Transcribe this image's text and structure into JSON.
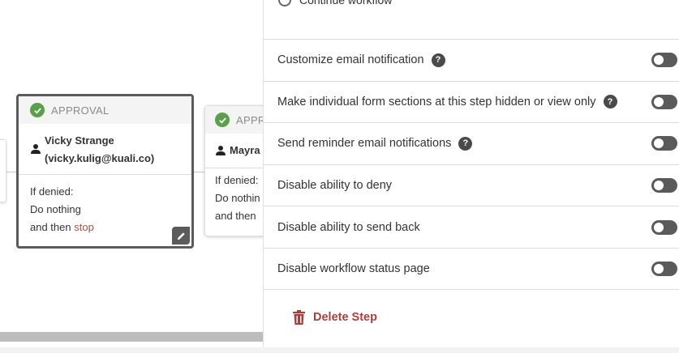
{
  "canvas": {
    "card1": {
      "type": "APPROVAL",
      "user_name": "Vicky Strange",
      "user_email": "(vicky.kulig@kuali.co)",
      "denied_label": "If denied:",
      "denied_action": "Do nothing",
      "denied_then": "and then",
      "denied_stop": "stop"
    },
    "card2": {
      "type": "APPR",
      "user_name": "Mayra",
      "denied_label": "If denied:",
      "denied_action": "Do nothin",
      "denied_then": "and then"
    }
  },
  "panel": {
    "radio_option": "Continue workflow",
    "settings": [
      {
        "label": "Customize email notification",
        "help": true
      },
      {
        "label": "Make individual form sections at this step hidden or view only",
        "help": true
      },
      {
        "label": "Send reminder email notifications",
        "help": true
      },
      {
        "label": "Disable ability to deny",
        "help": false
      },
      {
        "label": "Disable ability to send back",
        "help": false
      },
      {
        "label": "Disable workflow status page",
        "help": false
      }
    ],
    "help_glyph": "?",
    "delete_label": "Delete Step"
  },
  "colors": {
    "approval_check": "#5aa04a",
    "delete": "#a93f3a",
    "toggle_off": "#5a5a5a",
    "stop_link": "#a0524b"
  }
}
